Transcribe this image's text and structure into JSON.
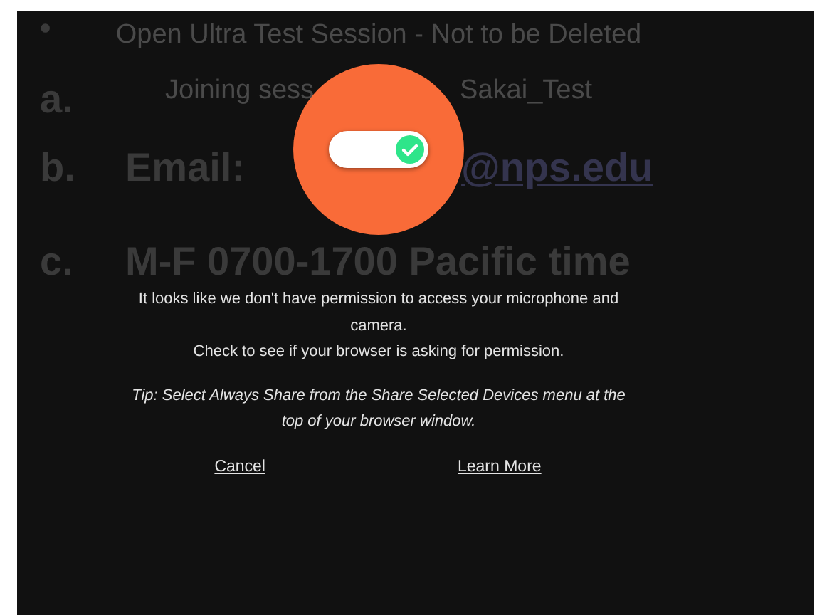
{
  "slide": {
    "bullet": "•",
    "items": [
      {
        "marker": "a."
      },
      {
        "marker": "b.",
        "parts": [
          {
            "kind": "text",
            "text": "Email:"
          },
          {
            "kind": "gap"
          },
          {
            "kind": "link",
            "text": "@nps.edu"
          }
        ]
      },
      {
        "marker": "c.",
        "parts": [
          {
            "kind": "text",
            "text": "M-F 0700-1700 Pacific time"
          }
        ]
      }
    ]
  },
  "session": {
    "title": "Open Ultra Test Session - Not to be Deleted",
    "joining_start": "Joining sess",
    "joining_end": "Sakai_Test"
  },
  "dialog": {
    "toggle": {
      "on": true
    },
    "message": [
      "It looks like we don't have permission to access your microphone and camera.",
      "Check to see if your browser is asking for permission."
    ],
    "tip": "Tip: Select Always Share from the Share Selected Devices menu at the top of your browser window.",
    "buttons": [
      {
        "label": "Cancel"
      },
      {
        "label": "Learn More"
      }
    ]
  }
}
